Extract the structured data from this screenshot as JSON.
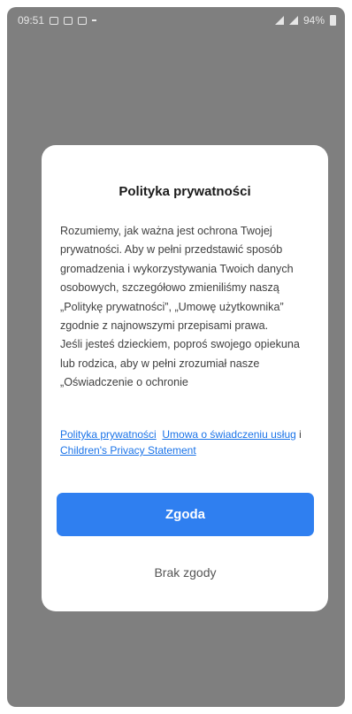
{
  "status_bar": {
    "time": "09:51",
    "battery": "94%"
  },
  "dialog": {
    "title": "Polityka prywatności",
    "paragraph1": "Rozumiemy, jak ważna jest ochrona Twojej prywatności. Aby w pełni przedstawić sposób gromadzenia i wykorzystywania Twoich danych osobowych, szczegółowo zmieniliśmy naszą „Politykę prywatności”, „Umowę użytkownika” zgodnie z najnowszymi przepisami prawa.",
    "paragraph2": "Jeśli jesteś dzieckiem, poproś swojego opiekuna lub rodzica, aby w pełni zrozumiał nasze „Oświadczenie o ochronie",
    "links": {
      "privacy_policy": "Polityka prywatności",
      "service_agreement": "Umowa o świadczeniu usług",
      "separator": "i",
      "children_statement": "Children's Privacy Statement"
    },
    "agree_label": "Zgoda",
    "disagree_label": "Brak zgody"
  },
  "colors": {
    "overlay": "#7f7f7f",
    "accent": "#2f7ff0",
    "link": "#1a73e8"
  }
}
